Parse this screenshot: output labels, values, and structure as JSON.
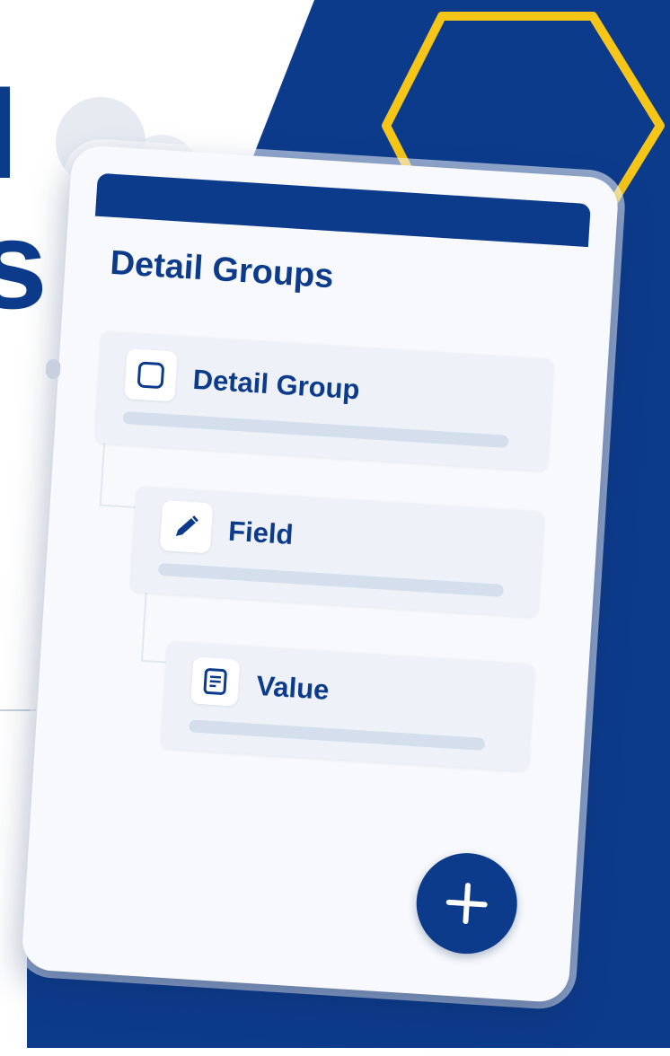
{
  "hero": {
    "letter_top": "l",
    "letter_bottom": "s"
  },
  "card": {
    "title": "Detail Groups",
    "items": [
      {
        "label": "Detail Group",
        "icon": "checkbox-icon"
      },
      {
        "label": "Field",
        "icon": "pencil-icon"
      },
      {
        "label": "Value",
        "icon": "document-icon"
      }
    ],
    "fab_icon": "plus-icon"
  },
  "colors": {
    "brand_blue": "#0d3b8c",
    "accent_yellow": "#f5c518",
    "card_bg": "#f7f9fc",
    "item_bg": "#eef2f8"
  }
}
